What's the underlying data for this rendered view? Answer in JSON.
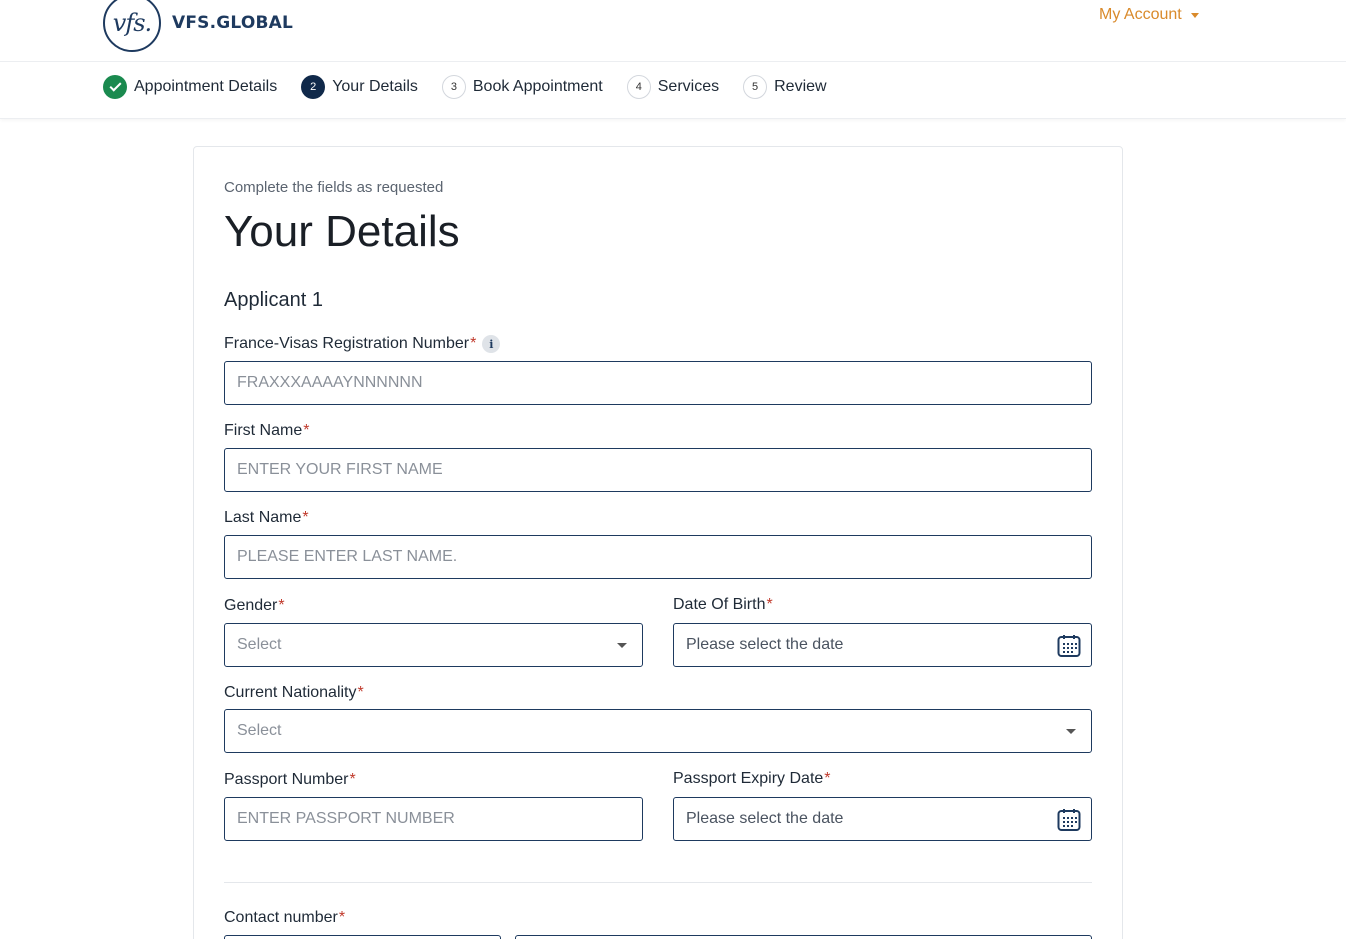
{
  "header": {
    "logo_mark": "vfs.",
    "logo_text": "VFS.GLOBAL",
    "account_label": "My Account"
  },
  "stepper": {
    "steps": [
      {
        "number": "",
        "label": "Appointment Details",
        "state": "done"
      },
      {
        "number": "2",
        "label": "Your Details",
        "state": "active"
      },
      {
        "number": "3",
        "label": "Book Appointment",
        "state": "todo"
      },
      {
        "number": "4",
        "label": "Services",
        "state": "todo"
      },
      {
        "number": "5",
        "label": "Review",
        "state": "todo"
      }
    ]
  },
  "form": {
    "subtitle": "Complete the fields as requested",
    "title": "Your Details",
    "applicant_heading": "Applicant 1",
    "required_mark": "*",
    "info_glyph": "i",
    "registration": {
      "label": "France-Visas Registration Number",
      "placeholder": "FRAXXXAAAAYNNNNNN"
    },
    "first_name": {
      "label": "First Name",
      "placeholder": "ENTER YOUR FIRST NAME"
    },
    "last_name": {
      "label": "Last Name",
      "placeholder": "PLEASE ENTER LAST NAME."
    },
    "gender": {
      "label": "Gender",
      "value": "Select"
    },
    "dob": {
      "label": "Date Of Birth",
      "placeholder": "Please select the date"
    },
    "nationality": {
      "label": "Current Nationality",
      "value": "Select"
    },
    "passport_number": {
      "label": "Passport Number",
      "placeholder": "ENTER PASSPORT NUMBER"
    },
    "passport_expiry": {
      "label": "Passport Expiry Date",
      "placeholder": "Please select the date"
    },
    "contact": {
      "label": "Contact number"
    }
  },
  "colors": {
    "brand_navy": "#1e3a5f",
    "accent_orange": "#d98a2b",
    "success_green": "#1a8a4f",
    "required_red": "#c0392b"
  },
  "icons": [
    "check-icon",
    "info-icon",
    "calendar-icon",
    "chevron-down-icon"
  ]
}
